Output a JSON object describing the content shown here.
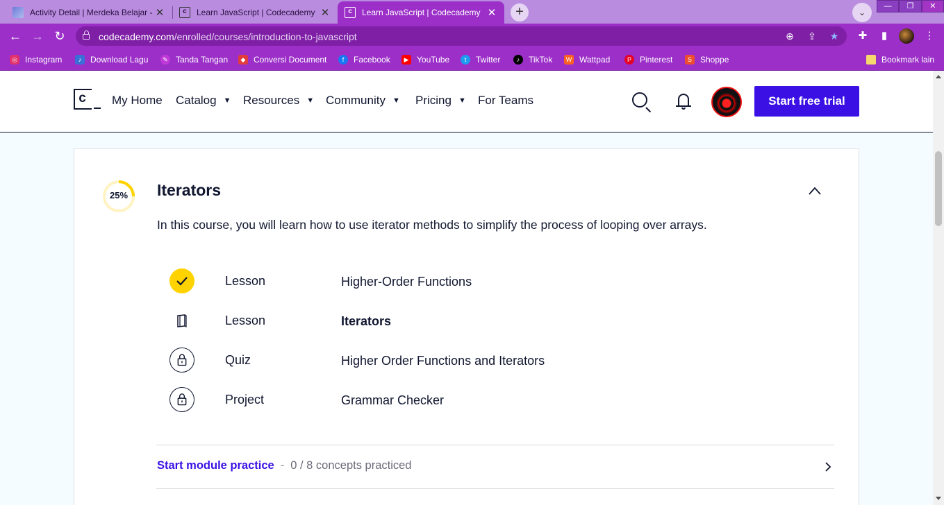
{
  "browser": {
    "tabs": [
      {
        "title": "Activity Detail | Merdeka Belajar -",
        "favicon": "merdeka-favicon",
        "active": false
      },
      {
        "title": "Learn JavaScript | Codecademy",
        "favicon": "codecademy-favicon",
        "active": false
      },
      {
        "title": "Learn JavaScript | Codecademy",
        "favicon": "codecademy-favicon",
        "active": true
      }
    ],
    "new_tab_label": "+",
    "url_host": "codecademy.com",
    "url_path": "/enrolled/courses/introduction-to-javascript",
    "bookmarks": [
      {
        "label": "Instagram",
        "icon": "instagram-icon",
        "color": "#e1306c"
      },
      {
        "label": "Download Lagu",
        "icon": "music-icon",
        "color": "#3b6fd8"
      },
      {
        "label": "Tanda Tangan",
        "icon": "signature-icon",
        "color": "#c03ad8"
      },
      {
        "label": "Conversi Document",
        "icon": "document-icon",
        "color": "#e23b3b"
      },
      {
        "label": "Facebook",
        "icon": "facebook-icon",
        "color": "#1877f2"
      },
      {
        "label": "YouTube",
        "icon": "youtube-icon",
        "color": "#ff0000"
      },
      {
        "label": "Twitter",
        "icon": "twitter-icon",
        "color": "#1d9bf0"
      },
      {
        "label": "TikTok",
        "icon": "tiktok-icon",
        "color": "#000000"
      },
      {
        "label": "Wattpad",
        "icon": "wattpad-icon",
        "color": "#ff6122"
      },
      {
        "label": "Pinterest",
        "icon": "pinterest-icon",
        "color": "#e60023"
      },
      {
        "label": "Shoppe",
        "icon": "shopee-icon",
        "color": "#ee4d2d"
      }
    ],
    "other_bookmarks": "Bookmark lain",
    "theme_color": "#9b2fc8"
  },
  "header": {
    "nav": [
      {
        "label": "My Home",
        "dropdown": false
      },
      {
        "label": "Catalog",
        "dropdown": true
      },
      {
        "label": "Resources",
        "dropdown": true
      },
      {
        "label": "Community",
        "dropdown": true
      },
      {
        "label": "Pricing",
        "dropdown": true
      },
      {
        "label": "For Teams",
        "dropdown": false
      }
    ],
    "cta_label": "Start free trial",
    "cta_color": "#3a10e5"
  },
  "module": {
    "progress_percent": 25,
    "progress_label": "25%",
    "progress_color": "#ffd300",
    "title": "Iterators",
    "description": "In this course, you will learn how to use iterator methods to simplify the process of looping over arrays.",
    "items": [
      {
        "type": "Lesson",
        "name": "Higher-Order Functions",
        "status": "completed",
        "icon": "check-icon"
      },
      {
        "type": "Lesson",
        "name": "Iterators",
        "status": "current",
        "icon": "book-icon"
      },
      {
        "type": "Quiz",
        "name": "Higher Order Functions and Iterators",
        "status": "locked",
        "icon": "lock-icon"
      },
      {
        "type": "Project",
        "name": "Grammar Checker",
        "status": "locked",
        "icon": "lock-icon"
      }
    ],
    "practice_link": "Start module practice",
    "practice_separator": "-",
    "practice_stat": "0 / 8 concepts practiced"
  }
}
